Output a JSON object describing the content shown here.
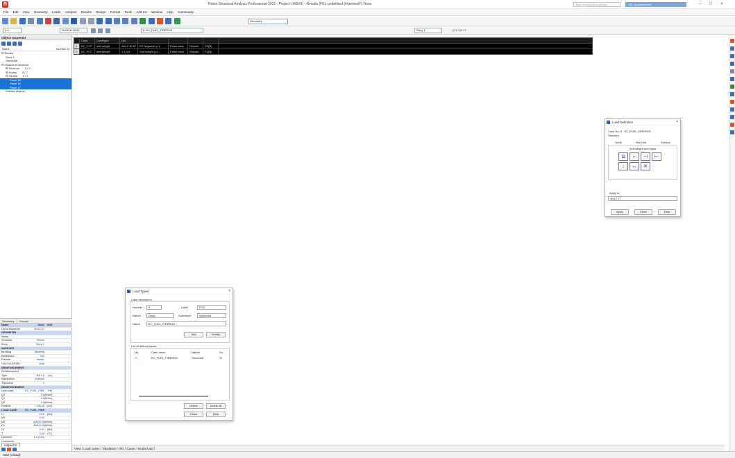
{
  "window": {
    "title": "Robot Structural Analysis Professional 2021 - Project: (W6X9) - Results (FE): undefined (Intermedi*) Trees",
    "search_placeholder": "Type a keyword or phrase",
    "account_label": "AE: Access/Invent",
    "minimize": "–",
    "maximize": "□",
    "close": "×"
  },
  "menu": [
    "File",
    "Edit",
    "View",
    "Geometry",
    "Loads",
    "Analysis",
    "Results",
    "Design",
    "Format",
    "Tools",
    "Add-Ins",
    "Window",
    "Help",
    "Community"
  ],
  "toolbar": {
    "layout_combo": "Geometry",
    "view_combo": "0.5",
    "case_combo": "5: EC_FUEL_FIREROS",
    "selection_combo": "1to12 at 16 87",
    "story_combo": "Story 1",
    "coords": "yFE W0 27"
  },
  "object_inspector": {
    "title": "Object Inspector",
    "column_name": "Name",
    "column_number": "Number of",
    "tree": [
      {
        "label": "⊟ Stories",
        "depth": 0,
        "count": "",
        "selected": false
      },
      {
        "label": "Story 1",
        "depth": 1,
        "count": "",
        "selected": false
      },
      {
        "label": "Structural",
        "depth": 1,
        "count": "",
        "selected": false
      },
      {
        "label": "⊟ Classes of sections",
        "depth": 0,
        "count": "",
        "selected": false
      },
      {
        "label": "⊞ Sections",
        "depth": 1,
        "count": "0 / 3",
        "selected": false
      },
      {
        "label": "⊞ Nodes",
        "depth": 1,
        "count": "0 / 7",
        "selected": false
      },
      {
        "label": "⊟ Panels",
        "depth": 1,
        "count": "0 / 3",
        "selected": false
      },
      {
        "label": "Panel 15",
        "depth": 2,
        "count": "",
        "selected": true
      },
      {
        "label": "Panel 16",
        "depth": 2,
        "count": "",
        "selected": true
      },
      {
        "label": "Panel 17",
        "depth": 2,
        "count": "",
        "selected": true
      },
      {
        "label": "Surface objects",
        "depth": 1,
        "count": "",
        "selected": false
      }
    ]
  },
  "properties": {
    "tabs": [
      "Geometry",
      "Groups"
    ],
    "headers": [
      "Name",
      "Value",
      "Unit"
    ],
    "rows": [
      {
        "name": "List of elements",
        "value": "4to12 27",
        "unit": "",
        "section": false
      },
      {
        "name": "GEOMETRY",
        "value": "",
        "unit": "",
        "section": true
      },
      {
        "name": "Name",
        "value": "",
        "unit": "",
        "section": false
      },
      {
        "name": "Structure",
        "value": "Planar",
        "unit": "",
        "section": false
      },
      {
        "name": "Story",
        "value": "Story 1",
        "unit": "",
        "section": false
      },
      {
        "name": "SUPPORT",
        "value": "",
        "unit": "",
        "section": true
      },
      {
        "name": "Bending",
        "value": "Bearing",
        "unit": "",
        "section": false
      },
      {
        "name": "Restrained",
        "value": "Yes",
        "unit": "",
        "section": false
      },
      {
        "name": "Preload",
        "value": "elastic",
        "unit": "",
        "section": false
      },
      {
        "name": "CALCULATION",
        "value": "Auto",
        "unit": "",
        "section": false
      },
      {
        "name": "REINFORCEMENT",
        "value": "",
        "unit": "",
        "section": true
      },
      {
        "name": "Reinforcement",
        "value": "",
        "unit": "",
        "section": false
      },
      {
        "name": "Type",
        "value": "BA 1.0",
        "unit": "(m)",
        "section": false
      },
      {
        "name": "Distribution",
        "value": "Uniform",
        "unit": "",
        "section": false
      },
      {
        "name": "Thickness",
        "value": "0",
        "unit": "",
        "section": false
      },
      {
        "name": "REINFORCEMENT LOAD",
        "value": "",
        "unit": "",
        "section": true
      },
      {
        "name": "Load case",
        "value": "EC_FUEL_FIRE",
        "unit": "Ref",
        "section": false
      },
      {
        "name": "QX",
        "value": "0.0",
        "unit": "(kN/m)",
        "section": false
      },
      {
        "name": "QY",
        "value": "0.0",
        "unit": "(kN/m)",
        "section": false
      },
      {
        "name": "QZ",
        "value": "0.0",
        "unit": "(kN/m)",
        "section": false
      },
      {
        "name": "Position",
        "value": "100.00",
        "unit": "(cm)",
        "section": false
      },
      {
        "name": "LOAD CASE",
        "value": "EC_FUEL_FIRE",
        "unit": "",
        "section": true
      },
      {
        "name": "N",
        "value": "10.0",
        "unit": "(kN)",
        "section": false
      },
      {
        "name": "MY",
        "value": "0.00",
        "unit": "",
        "section": false
      },
      {
        "name": "MZ",
        "value": "40000.00",
        "unit": "(kN/m)",
        "section": false
      },
      {
        "name": "FX",
        "value": "40000.00",
        "unit": "(kN/m)",
        "section": false
      },
      {
        "name": "FZ",
        "value": "0.00",
        "unit": "(kN)",
        "section": false
      },
      {
        "name": "T",
        "value": "0.00",
        "unit": "(°C)",
        "section": false
      },
      {
        "name": "Diameter",
        "value": "0.0 (mm)",
        "unit": "",
        "section": false
      },
      {
        "name": "Comments",
        "value": "",
        "unit": "",
        "section": false
      }
    ],
    "bottom_tab": "Inspector"
  },
  "loads_table": {
    "headers": [
      "Case",
      "Load type",
      "List",
      "",
      "",
      "",
      "",
      ""
    ],
    "rows": [
      {
        "num": "1",
        "cells": [
          "EC_FCF",
          "self-weight",
          "4to12 16 87",
          "PZ Negative y=1",
          "Entire struc",
          "Results",
          "FZ(N)"
        ]
      },
      {
        "num": "2",
        "cells": [
          "EC_FCF",
          "self-weight",
          "1 3 4 6",
          "Self-weight y=1",
          "Entire struc",
          "Results",
          "FZ(N)"
        ]
      }
    ]
  },
  "load_definition": {
    "title": "Load Definition",
    "case_text": "Case No: 5 - EC_FUEL_FIREROS",
    "subtitle": "Selected",
    "tabs": [
      "Node",
      "Bar/Line",
      "Surface"
    ],
    "group_label": "Self-weight and mass",
    "apply_to_label": "Apply to",
    "apply_to_value": "4to12 27",
    "apply": "Apply",
    "close": "Close",
    "help": "Help"
  },
  "load_types": {
    "title": "Load Types",
    "case_group": "Case description",
    "number_label": "Number",
    "number_value": "5",
    "label_label": "Label",
    "label_value": "EC5",
    "nature_label": "Nature",
    "nature_value": "Dead",
    "subnature_label": "Subnature",
    "subnature_value": "Structural",
    "name_label": "Name",
    "name_value": "EC_FUEL_FIREROS",
    "add": "Add",
    "modify": "Modify",
    "list_group": "List of defined cases",
    "list_headers": [
      "No.",
      "Case name",
      "Nature",
      "Su"
    ],
    "list_rows": [
      {
        "no": "5",
        "name": "EC_FUEL_FIREROS",
        "nature": "Structural",
        "su": "St"
      }
    ],
    "delete": "Delete",
    "delete_all": "Delete all",
    "close": "Close",
    "help": "Help"
  },
  "bottom_tabs": "View \\ Load cases \\ Tabulation \\ Info \\ Cases \\ Nodal load \\",
  "status": "Start (Cloud)",
  "colors": {
    "accent": "#1b73d3",
    "brand": "#d0342c",
    "table_bg": "#000000"
  }
}
